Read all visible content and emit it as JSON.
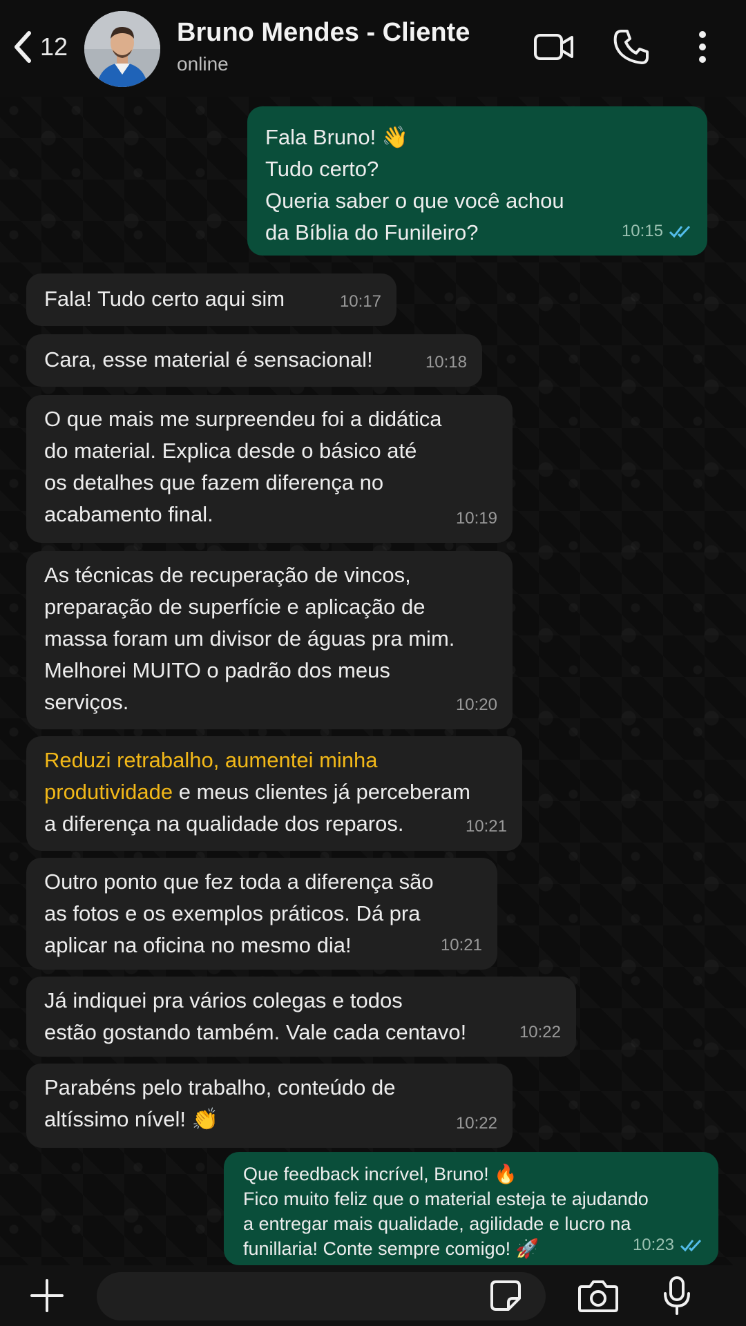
{
  "header": {
    "back_count": "12",
    "contact_name": "Bruno Mendes - Cliente",
    "status": "online",
    "icons": [
      "back-chevron-icon",
      "video-call-icon",
      "phone-call-icon",
      "more-options-icon"
    ]
  },
  "messages": [
    {
      "dir": "out",
      "text": "Fala Bruno! 👋\nTudo certo?\nQueria saber o que você achou\nda Bíblia do Funileiro?",
      "time": "10:15",
      "read": true
    },
    {
      "dir": "in",
      "text": "Fala! Tudo certo aqui sim",
      "time": "10:17"
    },
    {
      "dir": "in",
      "text": "Cara, esse material é sensacional!",
      "time": "10:18"
    },
    {
      "dir": "in",
      "text": "O que mais me surpreendeu foi a didática\ndo material. Explica desde o básico até\nos detalhes que fazem diferença no\nacabamento final.",
      "time": "10:19"
    },
    {
      "dir": "in",
      "text": "As técnicas de recuperação de vincos,\npreparação de superfície e aplicação de\nmassa foram um divisor de águas pra mim.\nMelhorei MUITO o padrão dos meus\nserviços.",
      "time": "10:20"
    },
    {
      "dir": "in",
      "highlight": "Reduzi retrabalho, aumentei minha\nprodutividade",
      "text": " e meus clientes já perceberam\na diferença na qualidade dos reparos.",
      "time": "10:21"
    },
    {
      "dir": "in",
      "text": "Outro ponto que fez toda a diferença são\nas fotos e os exemplos práticos. Dá pra\naplicar na oficina no mesmo dia!",
      "time": "10:21"
    },
    {
      "dir": "in",
      "text": "Já indiquei pra vários colegas e todos\nestão gostando também. Vale cada centavo!",
      "time": "10:22"
    },
    {
      "dir": "in",
      "text": "Parabéns pelo trabalho, conteúdo de\naltíssimo nível! 👏",
      "time": "10:22"
    },
    {
      "dir": "out",
      "text": "Que feedback incrível, Bruno! 🔥\nFico muito feliz que o material esteja te ajudando\na entregar mais qualidade, agilidade e lucro na\nfunillaria! Conte sempre comigo! 🚀",
      "time": "10:23",
      "read": true
    }
  ],
  "composer": {
    "icons": [
      "plus-icon",
      "sticker-icon",
      "camera-icon",
      "microphone-icon"
    ]
  },
  "colors": {
    "incoming_bubble": "#202020",
    "outgoing_bubble": "#0a4e3a",
    "highlight": "#f2b818",
    "read_ticks": "#53bdeb"
  }
}
